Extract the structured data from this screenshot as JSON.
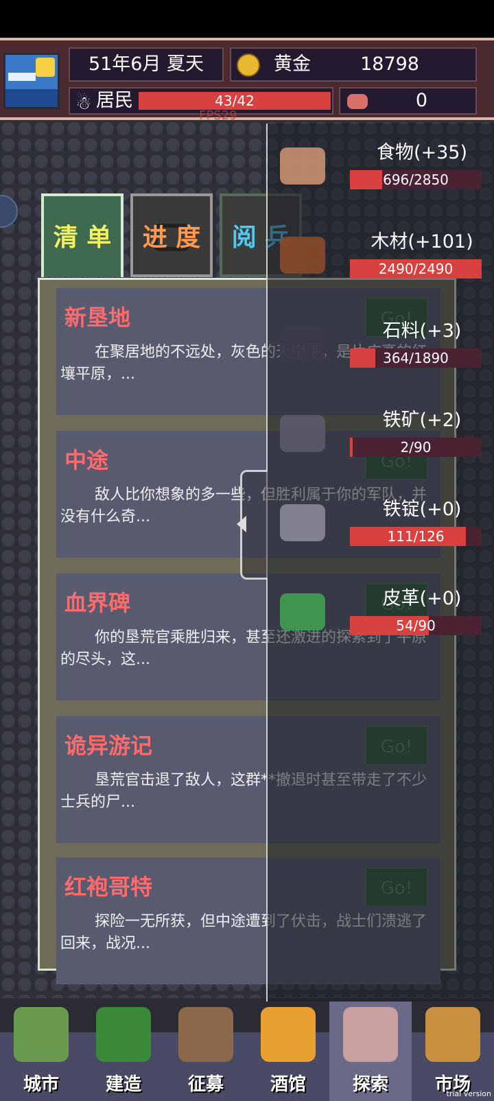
{
  "hud": {
    "date": "51年6月 夏天",
    "gold_label": "黄金",
    "gold_value": "18798",
    "residents_label": "居民",
    "residents_value": "43/42",
    "residents_progress": 1.0,
    "meat_value": "0",
    "fps": "FPS29"
  },
  "tabs": [
    {
      "label": "清 单",
      "color": "#f5f060"
    },
    {
      "label": "进 度",
      "color": "#ff9a50"
    },
    {
      "label": "阅 兵",
      "color": "#50c8f0"
    }
  ],
  "expeditions": [
    {
      "title": "新垦地",
      "body": "在聚居地的不远处，灰色的天空下，是片广袤的红壤平原，...",
      "go": "Go!"
    },
    {
      "title": "中途",
      "body": "敌人比你想象的多一些，但胜利属于你的军队，并没有什么奇...",
      "go": "Go!"
    },
    {
      "title": "血界碑",
      "body": "你的垦荒官乘胜归来，甚至还激进的探索到了平原的尽头，这...",
      "go": "Go!"
    },
    {
      "title": "诡异游记",
      "body": "垦荒官击退了敌人，这群**撤退时甚至带走了不少士兵的尸...",
      "go": "Go!"
    },
    {
      "title": "红袍哥特",
      "body": "探险一无所获，但中途遭到了伏击，战士们溃逃了回来，战况...",
      "go": "Go!"
    }
  ],
  "resources": [
    {
      "name": "食物(+35)",
      "value": "696/2850",
      "fill": 0.244,
      "icon": "bread-icon"
    },
    {
      "name": "木材(+101)",
      "value": "2490/2490",
      "fill": 1.0,
      "icon": "wood-icon"
    },
    {
      "name": "石料(+3)",
      "value": "364/1890",
      "fill": 0.193,
      "icon": "stone-icon"
    },
    {
      "name": "铁矿(+2)",
      "value": "2/90",
      "fill": 0.022,
      "icon": "iron-ore-icon"
    },
    {
      "name": "铁锭(+0)",
      "value": "111/126",
      "fill": 0.881,
      "icon": "iron-ingot-icon"
    },
    {
      "name": "皮革(+0)",
      "value": "54/90",
      "fill": 0.6,
      "icon": "leather-icon"
    }
  ],
  "nav": [
    {
      "label": "城市",
      "icon": "city-icon"
    },
    {
      "label": "建造",
      "icon": "build-icon"
    },
    {
      "label": "征募",
      "icon": "recruit-icon"
    },
    {
      "label": "酒馆",
      "icon": "tavern-icon"
    },
    {
      "label": "探索",
      "icon": "explore-icon"
    },
    {
      "label": "市场",
      "icon": "market-icon"
    }
  ],
  "watermark": "trial version"
}
